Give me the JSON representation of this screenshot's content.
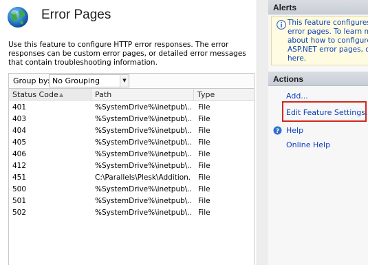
{
  "main": {
    "title": "Error Pages",
    "description": "Use this feature to configure HTTP error responses. The error responses can be custom error pages, or detailed error messages that contain troubleshooting information.",
    "group_by_label": "Group by:",
    "group_by_value": "No Grouping",
    "columns": [
      "Status Code",
      "Path",
      "Type"
    ],
    "rows": [
      {
        "code": "401",
        "path": "%SystemDrive%\\inetpub\\...",
        "type": "File"
      },
      {
        "code": "403",
        "path": "%SystemDrive%\\inetpub\\...",
        "type": "File"
      },
      {
        "code": "404",
        "path": "%SystemDrive%\\inetpub\\...",
        "type": "File"
      },
      {
        "code": "405",
        "path": "%SystemDrive%\\inetpub\\...",
        "type": "File"
      },
      {
        "code": "406",
        "path": "%SystemDrive%\\inetpub\\...",
        "type": "File"
      },
      {
        "code": "412",
        "path": "%SystemDrive%\\inetpub\\...",
        "type": "File"
      },
      {
        "code": "451",
        "path": "C:\\Parallels\\Plesk\\Addition...",
        "type": "File"
      },
      {
        "code": "500",
        "path": "%SystemDrive%\\inetpub\\...",
        "type": "File"
      },
      {
        "code": "501",
        "path": "%SystemDrive%\\inetpub\\...",
        "type": "File"
      },
      {
        "code": "502",
        "path": "%SystemDrive%\\inetpub\\...",
        "type": "File"
      }
    ]
  },
  "alerts": {
    "header": "Alerts",
    "text": "This feature configures I\nerror pages. To learn m\nabout how to configure \nASP.NET error pages, cl\nhere."
  },
  "actions": {
    "header": "Actions",
    "add": "Add...",
    "edit_feature_settings": "Edit Feature Settings...",
    "help": "Help",
    "online_help": "Online Help"
  },
  "colors": {
    "link": "#0b3fbf",
    "highlight_border": "#d0281c",
    "alert_background": "#fffbe0"
  }
}
